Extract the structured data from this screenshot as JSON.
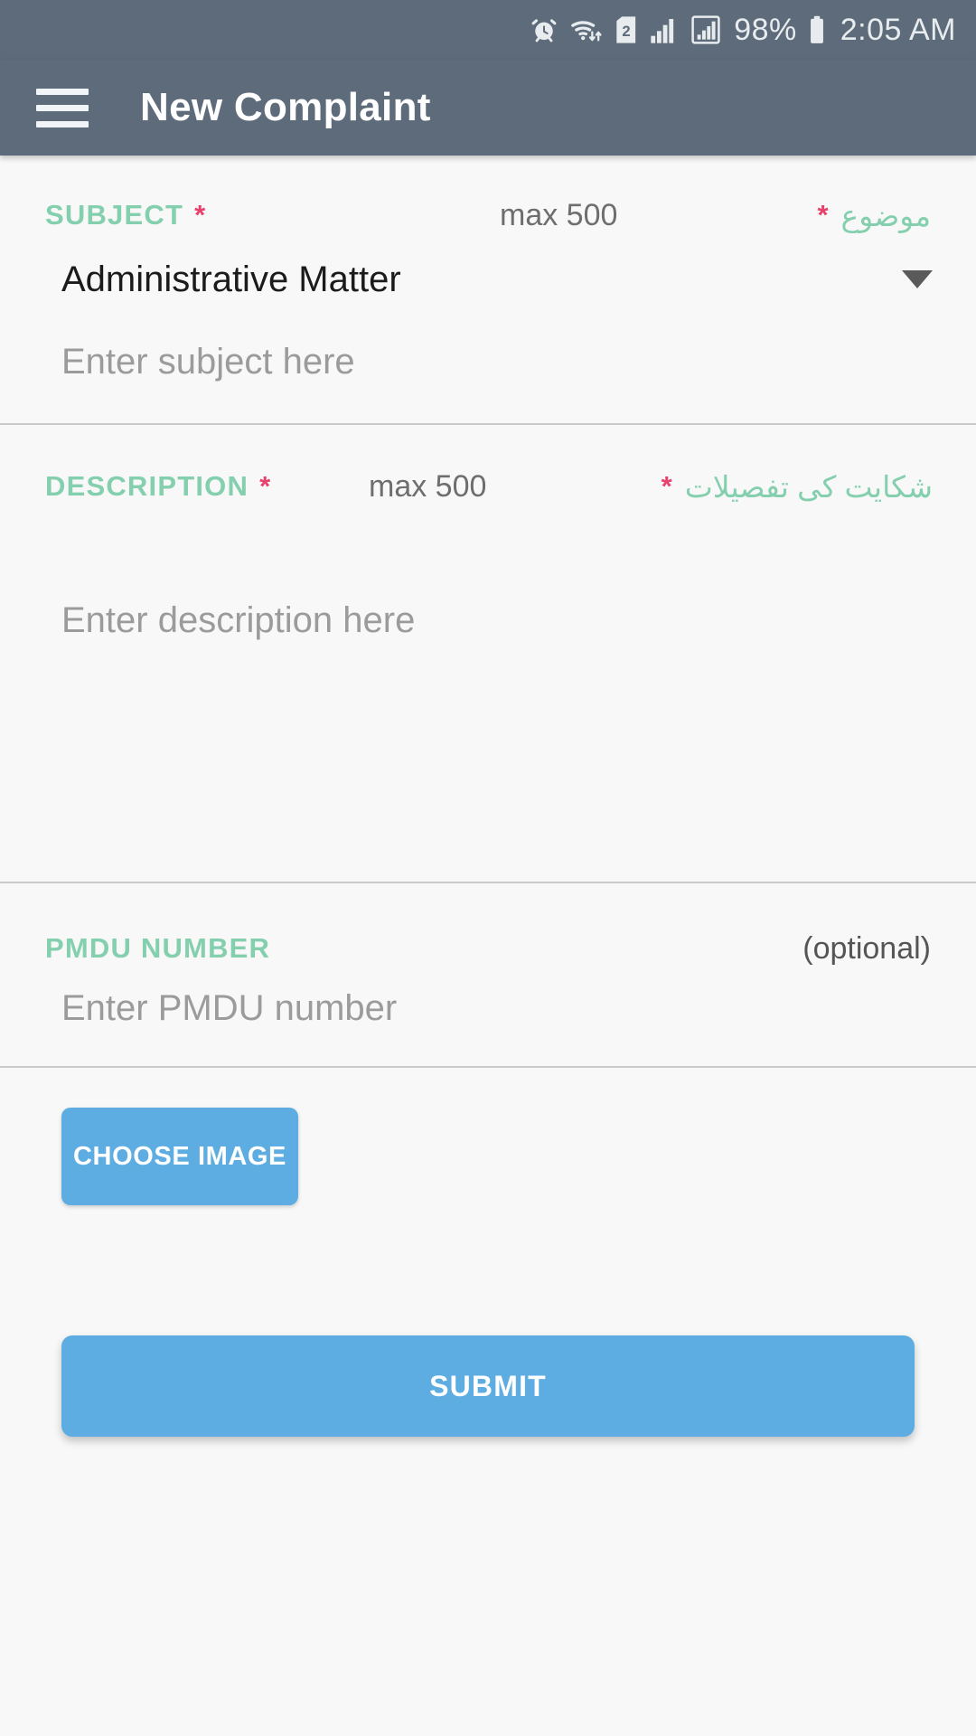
{
  "statusbar": {
    "icons": [
      "alarm-icon",
      "wifi-icon",
      "sim-2-icon",
      "signal-bars-icon",
      "signal-boxed-icon"
    ],
    "sim_badge": "2",
    "battery_percent": "98%",
    "time": "2:05 AM"
  },
  "appbar": {
    "menu_icon": "hamburger-menu-icon",
    "title": "New Complaint",
    "background": "#5d6b7a"
  },
  "form": {
    "subject": {
      "label_en": "SUBJECT",
      "required_mark": "*",
      "max_note": "max 500",
      "label_ur": "موضوع",
      "selected_option": "Administrative Matter",
      "dropdown_icon": "chevron-down-icon",
      "input_placeholder": "Enter subject here",
      "input_value": ""
    },
    "description": {
      "label_en": "DESCRIPTION",
      "required_mark": "*",
      "max_note": "max 500",
      "label_ur": "شکایت کی تفصیلات",
      "input_placeholder": "Enter description here",
      "input_value": ""
    },
    "pmdu": {
      "label_en": "PMDU NUMBER",
      "optional_note": "(optional)",
      "input_placeholder": "Enter PMDU number",
      "input_value": ""
    },
    "actions": {
      "choose_image_label": "CHOOSE IMAGE",
      "submit_label": "SUBMIT",
      "accent_color": "#5eade2"
    }
  },
  "colors": {
    "label_green": "#84cfae",
    "required_red": "#e8416b",
    "page_background": "#f8f8f8"
  }
}
